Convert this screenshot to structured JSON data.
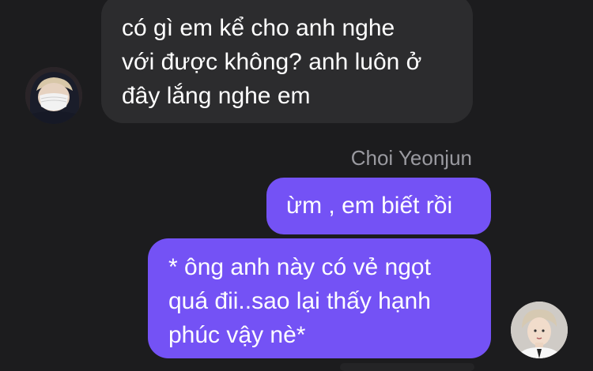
{
  "conversation": {
    "incoming": {
      "text": "có gì em kể cho anh nghe\nvới được không? anh luôn ở\nđây lắng nghe em",
      "sender_name": "Choi Yeonjun",
      "avatar_icon": "masked-person-avatar"
    },
    "outgoing": [
      {
        "text": "ừm , em biết rồi"
      },
      {
        "text": "* ông anh này có vẻ ngọt\nquá đii..sao lại thấy hạnh\nphúc vậy nè*"
      }
    ],
    "outgoing_avatar_icon": "person-avatar"
  },
  "colors": {
    "background": "#1c1c1e",
    "incoming_bubble": "#2c2c2e",
    "outgoing_bubble": "#7452f5",
    "sender_name": "#9a9aa0"
  }
}
